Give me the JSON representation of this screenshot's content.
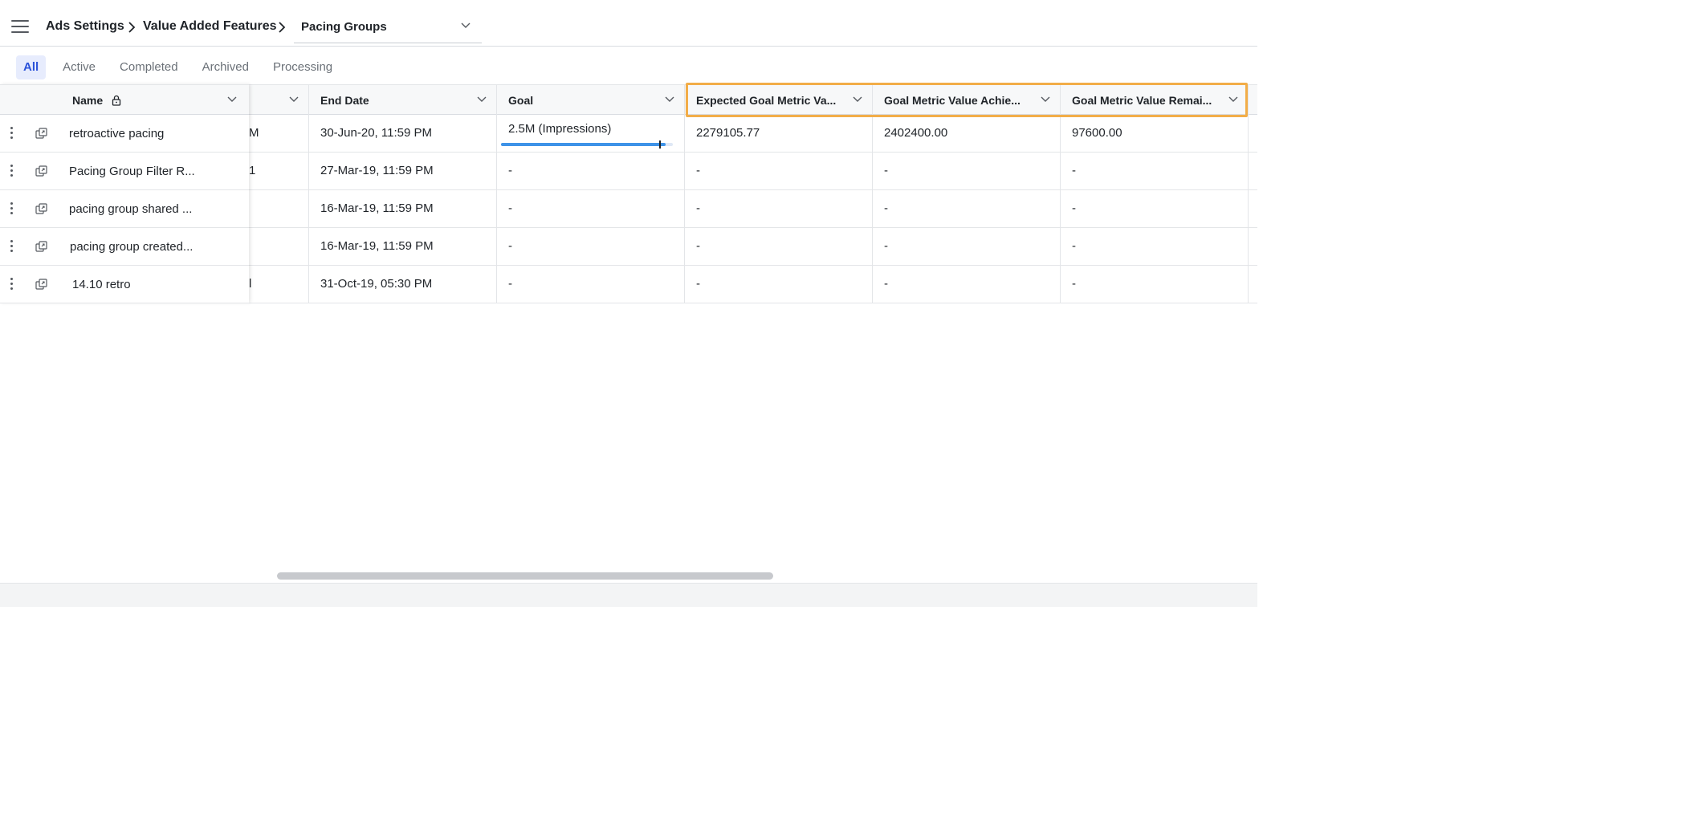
{
  "breadcrumb": {
    "items": [
      "Ads Settings",
      "Value Added Features"
    ],
    "current": "Pacing Groups"
  },
  "tabs": [
    "All",
    "Active",
    "Completed",
    "Archived",
    "Processing"
  ],
  "active_tab": "All",
  "columns": {
    "name": "Name",
    "start_partial": "",
    "end_date": "End Date",
    "goal": "Goal",
    "expected": "Expected Goal Metric Va...",
    "achieved": "Goal Metric Value Achie...",
    "remaining": "Goal Metric Value Remai..."
  },
  "rows": [
    {
      "name": "retroactive pacing",
      "start_partial": "M",
      "end_date": "30-Jun-20, 11:59 PM",
      "goal": "2.5M (Impressions)",
      "expected": "2279105.77",
      "achieved": "2402400.00",
      "remaining": "97600.00"
    },
    {
      "name": "Pacing Group Filter R...",
      "start_partial": "1",
      "end_date": "27-Mar-19, 11:59 PM",
      "goal": "-",
      "expected": "-",
      "achieved": "-",
      "remaining": "-"
    },
    {
      "name": "pacing group shared ...",
      "start_partial": "",
      "end_date": "16-Mar-19, 11:59 PM",
      "goal": "-",
      "expected": "-",
      "achieved": "-",
      "remaining": "-"
    },
    {
      "name": "pacing group created...",
      "start_partial": "",
      "end_date": "16-Mar-19, 11:59 PM",
      "goal": "-",
      "expected": "-",
      "achieved": "-",
      "remaining": "-"
    },
    {
      "name": "14.10 retro",
      "start_partial": "l",
      "end_date": "31-Oct-19, 05:30 PM",
      "goal": "-",
      "expected": "-",
      "achieved": "-",
      "remaining": "-"
    }
  ],
  "goal_progress": {
    "achieved_fraction": 0.96,
    "target_fraction": 0.92
  },
  "colors": {
    "accent": "#2b52d9",
    "highlight": "#f2ad48",
    "progress": "#3e93e8"
  },
  "icons": {
    "menu": "hamburger-icon",
    "chevron": "chevron-down-icon",
    "lock": "lock-icon",
    "row_menu": "kebab-icon",
    "row_action": "copy-icon"
  }
}
